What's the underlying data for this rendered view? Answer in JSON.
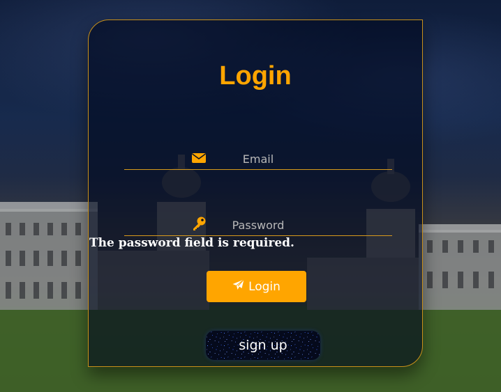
{
  "login": {
    "title": "Login",
    "email": {
      "placeholder": "Email",
      "value": "",
      "icon": "envelope-icon"
    },
    "password": {
      "placeholder": "Password",
      "value": "",
      "icon": "key-icon"
    },
    "error_message": "The password field is required.",
    "login_button": {
      "label": "Login",
      "icon": "paper-plane-icon"
    },
    "signup_button": {
      "label": "sign up"
    }
  },
  "colors": {
    "accent": "#ffa500",
    "card_border": "#c8901a",
    "text": "#ffffff"
  }
}
